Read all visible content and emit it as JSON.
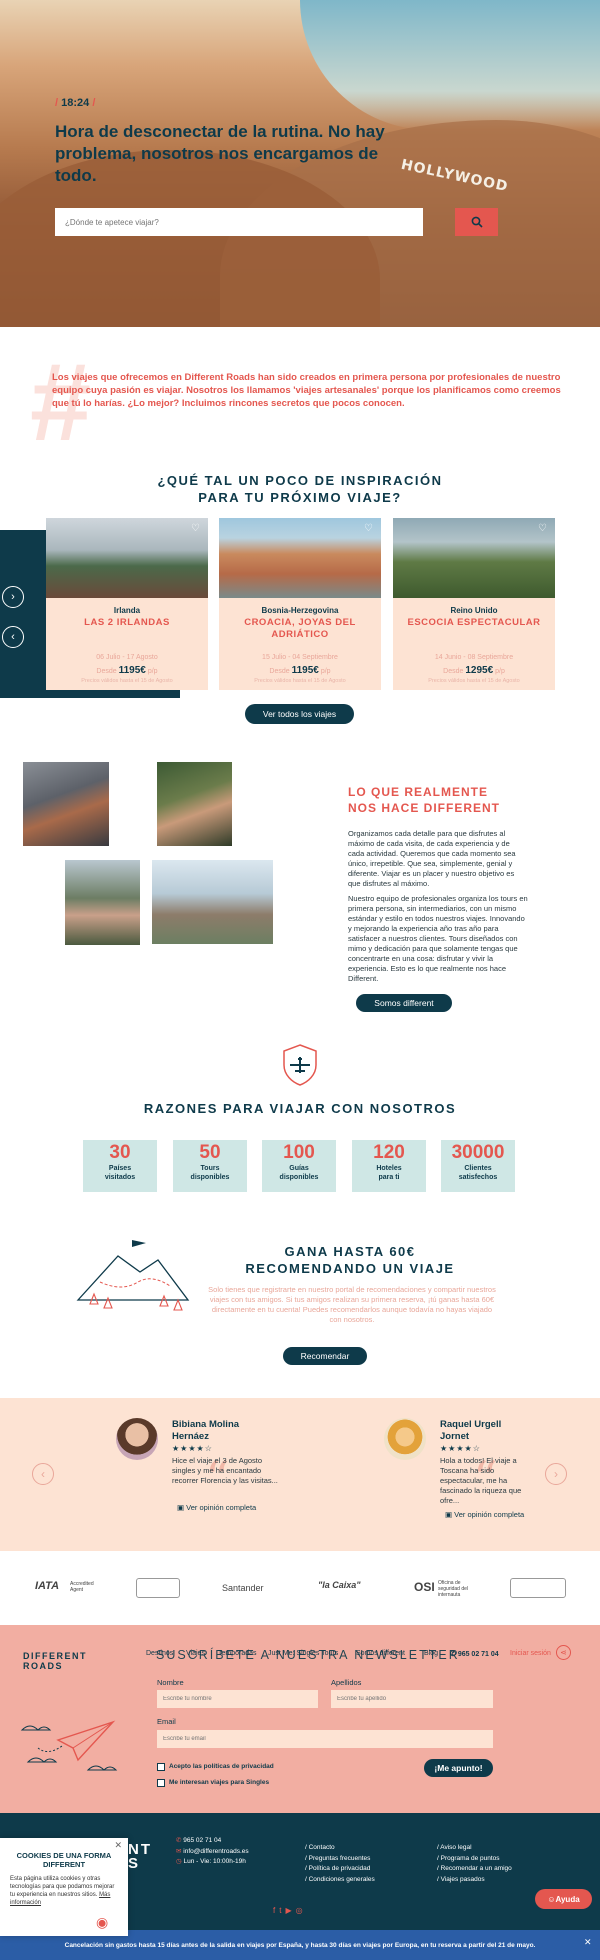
{
  "hero": {
    "time": "18:24",
    "headline": "Hora de desconectar de la rutina. No hay problema, nosotros nos encargamos de todo.",
    "search_placeholder": "¿Dónde te apetece viajar?",
    "bg_word": "HOLLYWOOD"
  },
  "intro": "Los viajes que ofrecemos en Different Roads han sido creados en primera persona por profesionales de nuestro equipo cuya pasión es viajar. Nosotros los llamamos 'viajes artesanales' porque los planificamos como creemos que tú lo harías. ¿Lo mejor? Incluimos rincones secretos que pocos conocen.",
  "inspiration": {
    "title_line1": "¿QUÉ TAL UN POCO DE INSPIRACIÓN",
    "title_line2": "PARA TU PRÓXIMO VIAJE?",
    "button": "Ver todos los viajes",
    "cards": [
      {
        "country": "Irlanda",
        "name": "LAS 2 IRLANDAS",
        "dates": "06 Julio - 17 Agosto",
        "from": "Desde",
        "price": "1195€",
        "per": "p/p",
        "note": "Precios válidos hasta el 15 de Agosto"
      },
      {
        "country": "Bosnia-Herzegovina",
        "name": "CROACIA, JOYAS DEL ADRIÁTICO",
        "dates": "15 Julio - 04 Septiembre",
        "from": "Desde",
        "price": "1195€",
        "per": "p/p",
        "note": "Precios válidos hasta el 15 de Agosto"
      },
      {
        "country": "Reino Unido",
        "name": "ESCOCIA ESPECTACULAR",
        "dates": "14 Junio - 08 Septiembre",
        "from": "Desde",
        "price": "1295€",
        "per": "p/p",
        "note": "Precios válidos hasta el 15 de Agosto"
      }
    ]
  },
  "different": {
    "title_line1": "LO QUE REALMENTE",
    "title_line2": "NOS HACE DIFFERENT",
    "p1": "Organizamos cada detalle para que disfrutes al máximo de cada visita, de cada experiencia y de cada actividad. Queremos que cada momento sea único, irrepetible. Que sea, simplemente, genial y diferente. Viajar es un placer y nuestro objetivo es que disfrutes al máximo.",
    "p2": "Nuestro equipo de profesionales organiza los tours en primera persona, sin intermediarios, con un mismo estándar y estilo en todos nuestros viajes. Innovando y mejorando la experiencia año tras año para satisfacer a nuestros clientes. Tours diseñados con mimo y dedicación para que solamente tengas que concentrarte en una cosa: disfrutar y vivir la experiencia. Esto es lo que realmente nos hace Different.",
    "button": "Somos different"
  },
  "reasons": {
    "title": "RAZONES PARA VIAJAR CON NOSOTROS",
    "stats": [
      {
        "n": "30",
        "l1": "Países",
        "l2": "visitados"
      },
      {
        "n": "50",
        "l1": "Tours",
        "l2": "disponibles"
      },
      {
        "n": "100",
        "l1": "Guías",
        "l2": "disponibles"
      },
      {
        "n": "120",
        "l1": "Hoteles",
        "l2": "para ti"
      },
      {
        "n": "30000",
        "l1": "Clientes",
        "l2": "satisfechos"
      }
    ]
  },
  "referral": {
    "title_line1": "GANA HASTA 60€",
    "title_line2": "RECOMENDANDO UN VIAJE",
    "text": "Solo tienes que registrarte en nuestro portal de recomendaciones y compartir nuestros viajes con tus amigos. Si tus amigos realizan su primera reserva, ¡tú ganas hasta 60€ directamente en tu cuenta! Puedes recomendarlos aunque todavía no hayas viajado con nosotros.",
    "button": "Recomendar"
  },
  "testimonials": [
    {
      "name_line1": "Bibiana Molina",
      "name_line2": "Hernáez",
      "stars": "★★★★☆",
      "text": "Hice el viaje el 3 de Agosto singles y me ha encantado recorrer Florencia y las visitas...",
      "link": "Ver opinión completa"
    },
    {
      "name_line1": "Raquel Urgell",
      "name_line2": "Jornet",
      "stars": "★★★★☆",
      "text": "Hola a todos! El viaje a Toscana ha sido espectacular, me ha fascinado la riqueza que ofre...",
      "link": "Ver opinión completa"
    }
  ],
  "partners": [
    "IATA",
    "Accredited Agent",
    "Santander",
    "\"la Caixa\"",
    "OSI",
    "Oficina de seguridad del internauta"
  ],
  "footer_nav": {
    "logo_line1": "DIFFERENT",
    "logo_line2": "ROADS",
    "items": [
      "Destinos",
      "Viajes",
      "Temporadas",
      "Just Me: Singles Tours",
      "Somos different",
      "Blog"
    ],
    "phone": "965 02 71 04",
    "login": "Iniciar sesión"
  },
  "newsletter": {
    "title": "SUSCRÍBETE A NUESTRA NEWSLETTER",
    "name_label": "Nombre",
    "name_placeholder": "Escribe tu nombre",
    "surname_label": "Apellidos",
    "surname_placeholder": "Escribe tu apellido",
    "email_label": "Email",
    "email_placeholder": "Escribe tu email",
    "privacy": "Acepto las políticas de privacidad",
    "singles": "Me interesan viajes para Singles",
    "submit": "¡Me apunto!"
  },
  "footer": {
    "logo_fragment_1": "NT",
    "logo_fragment_2": "S",
    "contact": [
      "965 02 71 04",
      "info@differentroads.es",
      "Lun - Vie: 10:00h-19h"
    ],
    "col1": [
      "/ Contacto",
      "/ Preguntas frecuentes",
      "/ Política de privacidad",
      "/ Condiciones generales"
    ],
    "col2": [
      "/ Aviso legal",
      "/ Programa de puntos",
      "/ Recomendar a un amigo",
      "/ Viajes pasados"
    ],
    "help": "Ayuda"
  },
  "cookies": {
    "title_line1": "COOKIES DE UNA FORMA",
    "title_line2": "DIFFERENT",
    "text": "Esta página utiliza cookies y otras tecnologías para que podamos mejorar tu experiencia en nuestros sitios.",
    "link": "Más información"
  },
  "bottom_bar": "Cancelación sin gastos hasta 15 días antes de la salida en viajes por España, y hasta 30 días en viajes por Europa, en tu reserva a partir del 21 de mayo.",
  "colors": {
    "navy": "#0e3a4a",
    "coral": "#e4574f",
    "peach": "#fde3d3",
    "mint": "#cfe7e5",
    "pink": "#f2aea2"
  }
}
